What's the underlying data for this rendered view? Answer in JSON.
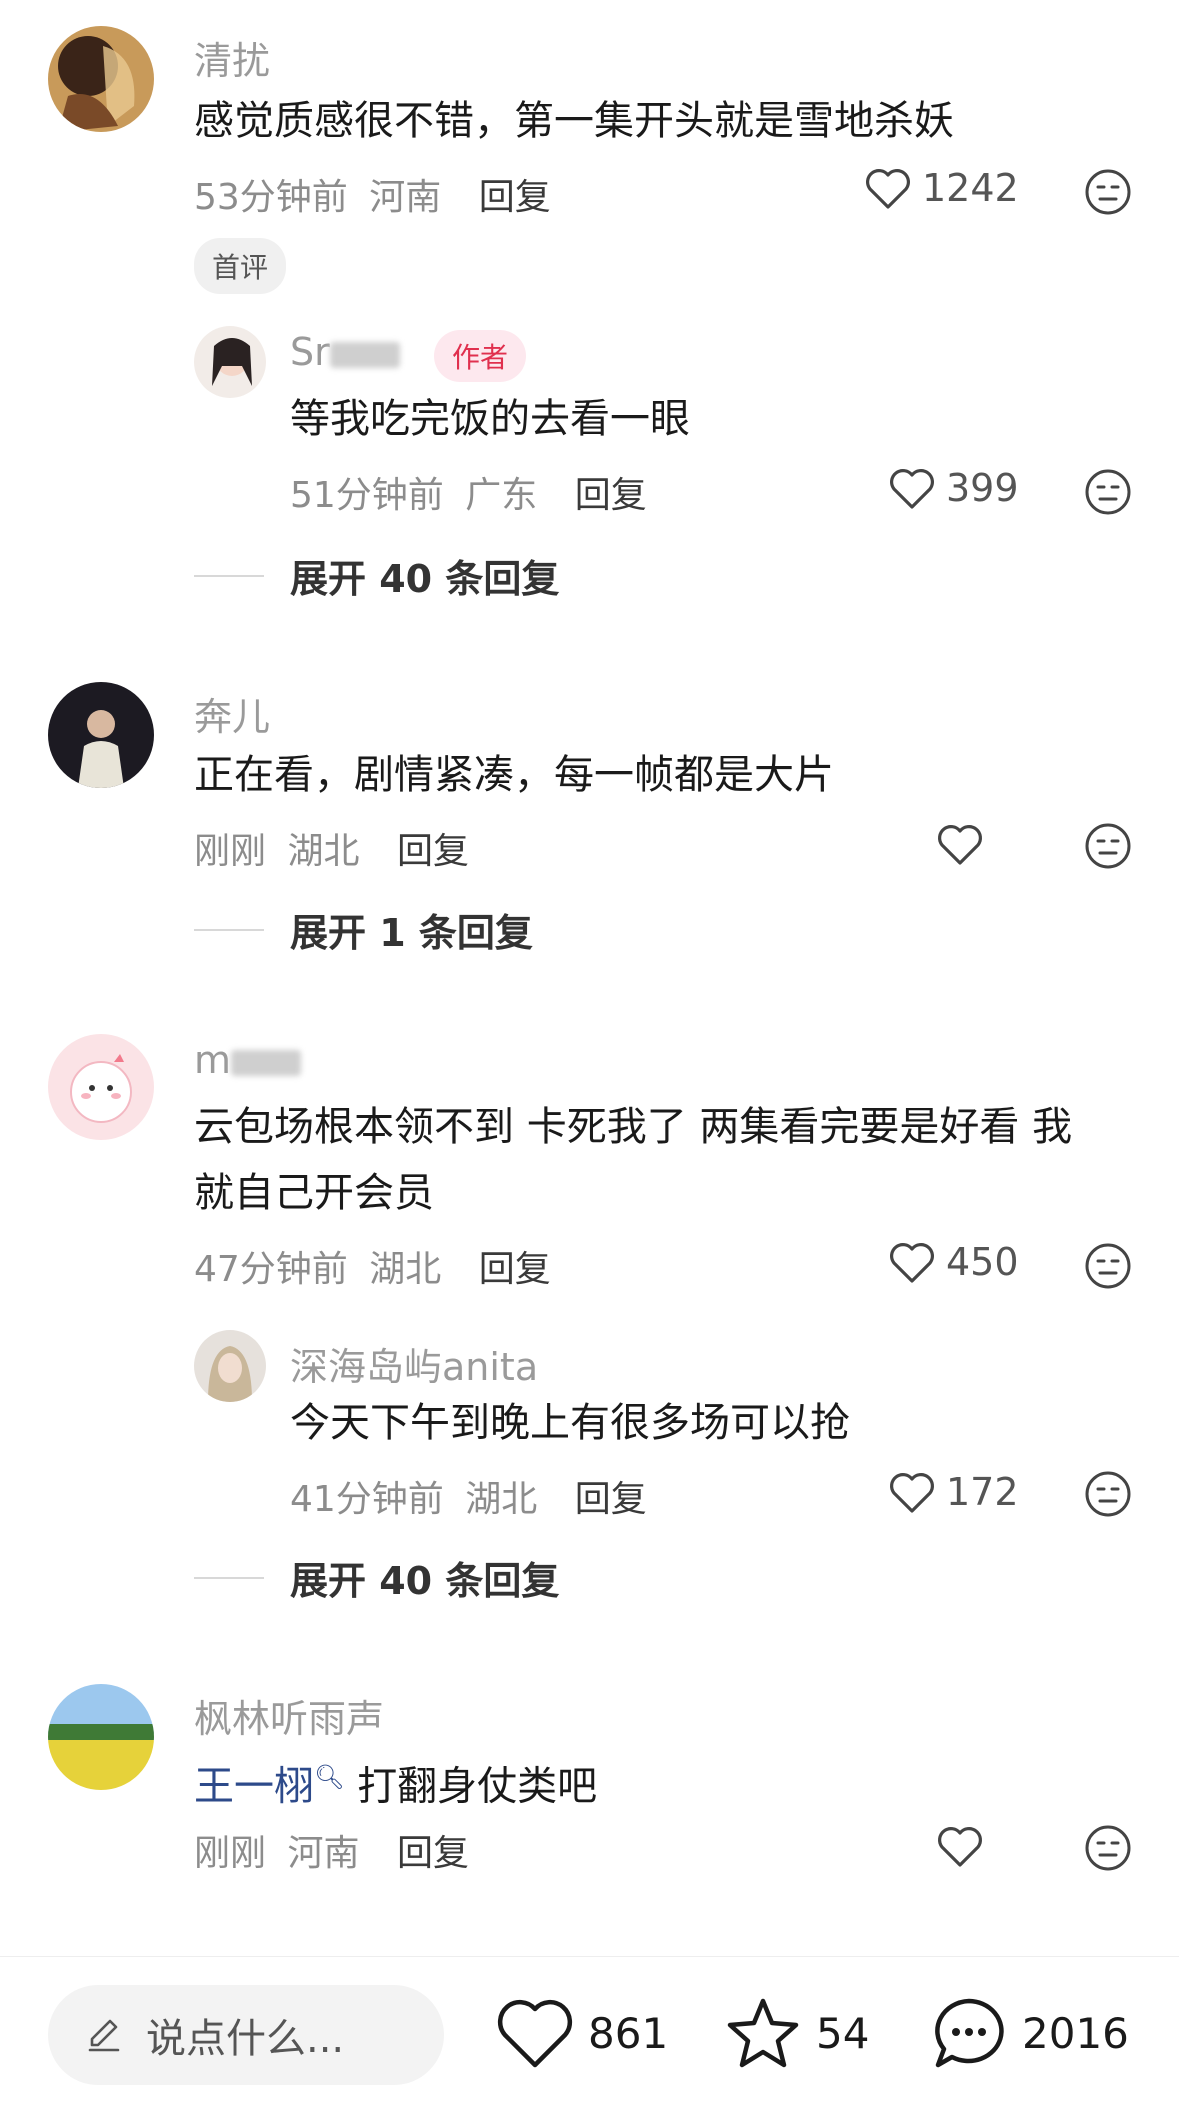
{
  "comments": [
    {
      "username": "清扰",
      "text": "感觉质感很不错，第一集开头就是雪地杀妖",
      "time": "53分钟前",
      "location": "河南",
      "reply": "回复",
      "likes": "1242",
      "badge": "首评",
      "sub_reply": {
        "username": "Sr",
        "tag": "作者",
        "text": "等我吃完饭的去看一眼",
        "time": "51分钟前",
        "location": "广东",
        "reply": "回复",
        "likes": "399"
      },
      "expand": "展开 40 条回复"
    },
    {
      "username": "奔儿",
      "text": "正在看，剧情紧凑，每一帧都是大片",
      "time": "刚刚",
      "location": "湖北",
      "reply": "回复",
      "likes": "",
      "expand": "展开 1 条回复"
    },
    {
      "username": "m",
      "text_line1": "云包场根本领不到 卡死我了 两集看完要是好看 我",
      "text_line2": "就自己开会员",
      "time": "47分钟前",
      "location": "湖北",
      "reply": "回复",
      "likes": "450",
      "sub_reply": {
        "username": "深海岛屿anita",
        "text": "今天下午到晚上有很多场可以抢",
        "time": "41分钟前",
        "location": "湖北",
        "reply": "回复",
        "likes": "172"
      },
      "expand": "展开 40 条回复"
    },
    {
      "username": "枫林听雨声",
      "mention": "王一栩",
      "text": "打翻身仗类吧",
      "time": "刚刚",
      "location": "河南",
      "reply": "回复",
      "likes": ""
    }
  ],
  "bottom_bar": {
    "placeholder": "说点什么...",
    "likes": "861",
    "favorites": "54",
    "comments": "2016"
  },
  "colors": {
    "mention": "#2d4a8a",
    "author_tag": "#e0304e",
    "meta": "#8c8c8c"
  }
}
